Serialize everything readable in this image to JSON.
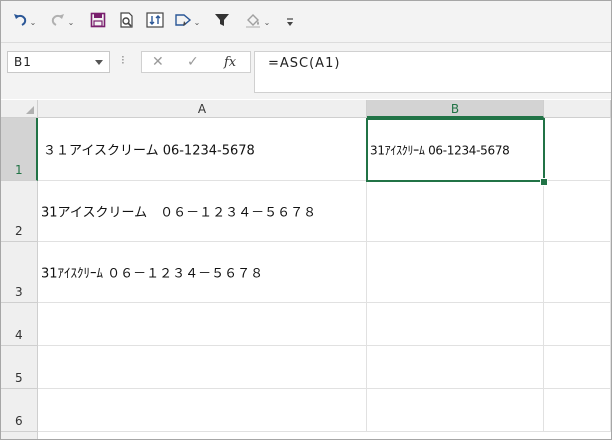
{
  "toolbar": {
    "icons": [
      "undo-icon",
      "redo-icon",
      "save-icon",
      "print-preview-icon",
      "sort-icon",
      "shape-icon",
      "filter-icon",
      "fill-color-icon",
      "customize-icon"
    ],
    "accent": "#217346"
  },
  "formula_bar": {
    "name_box": "B1",
    "fx_label": "fx",
    "formula": "=ASC(A1)"
  },
  "columns": [
    "A",
    "B"
  ],
  "rows": [
    "1",
    "2",
    "3",
    "4",
    "5",
    "6"
  ],
  "cells": {
    "A1": "３１アイスクリーム 06-1234-5678",
    "B1": "31ｱｲｽｸﾘｰﾑ 06-1234-5678",
    "A2": "31アイスクリーム　０６－１２３４－５６７８",
    "A3": "31ｱｲｽｸﾘｰﾑ ０６－１２３４－５６７８"
  }
}
